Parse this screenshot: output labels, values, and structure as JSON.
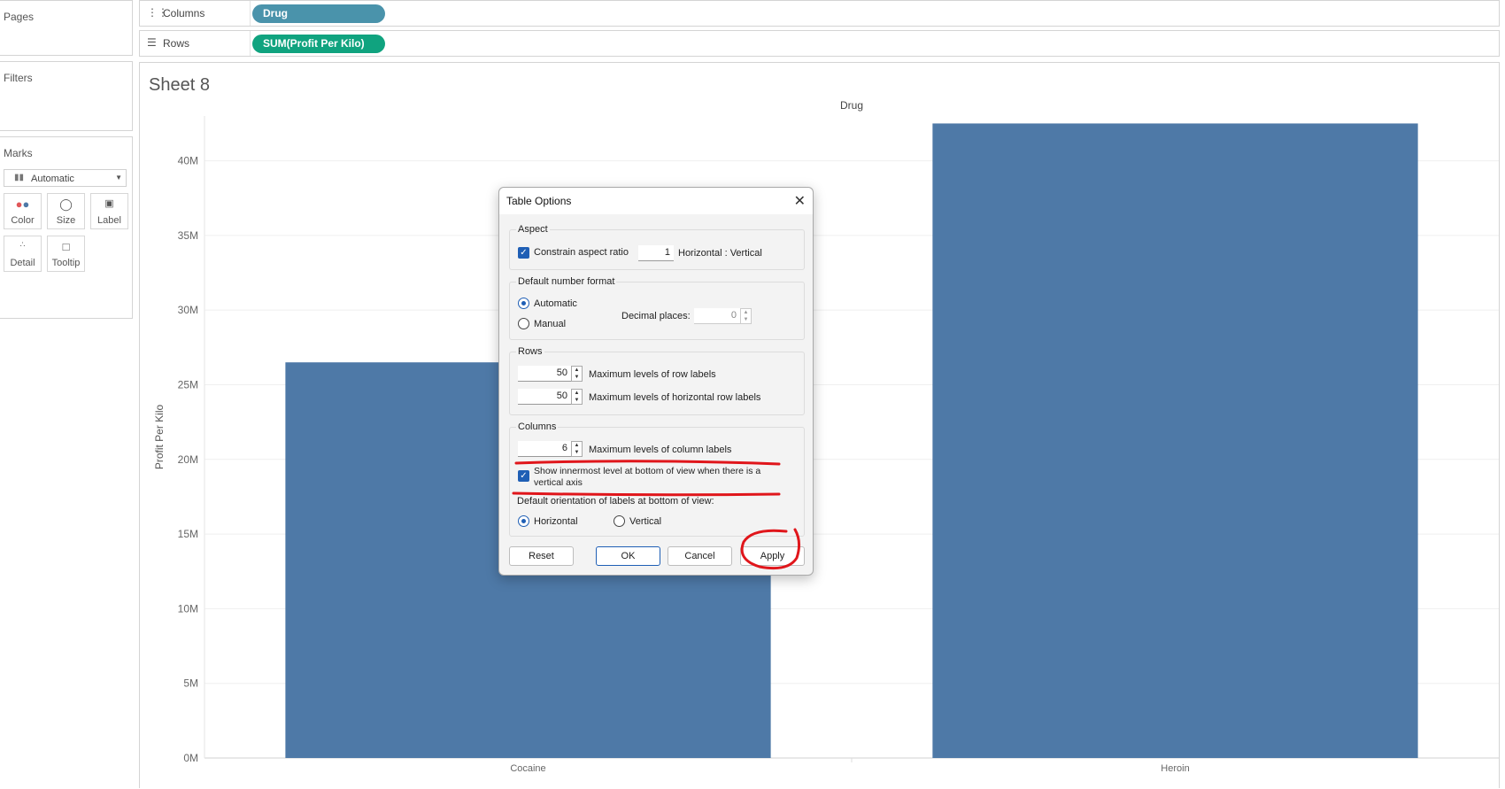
{
  "side_panes": {
    "pages_title": "Pages",
    "filters_title": "Filters",
    "marks_title": "Marks",
    "mark_type": "Automatic",
    "mark_buttons": [
      {
        "label": "Color",
        "icon": "color-dots-icon"
      },
      {
        "label": "Size",
        "icon": "size-icon"
      },
      {
        "label": "Label",
        "icon": "label-icon"
      },
      {
        "label": "Detail",
        "icon": "detail-icon"
      },
      {
        "label": "Tooltip",
        "icon": "tooltip-icon"
      }
    ]
  },
  "shelves": {
    "columns_label": "Columns",
    "columns_pill": "Drug",
    "rows_label": "Rows",
    "rows_pill": "SUM(Profit Per Kilo)"
  },
  "sheet": {
    "title": "Sheet 8"
  },
  "chart_data": {
    "type": "bar",
    "title": "",
    "column_header": "Drug",
    "categories": [
      "Cocaine",
      "Heroin"
    ],
    "values": [
      26500000,
      42500000
    ],
    "ylabel": "Profit Per Kilo",
    "ylim": [
      0,
      43000000
    ],
    "yticks": [
      "0M",
      "5M",
      "10M",
      "15M",
      "20M",
      "25M",
      "30M",
      "35M",
      "40M"
    ],
    "grid": true,
    "bar_color": "#4e79a7"
  },
  "dialog": {
    "title": "Table Options",
    "aspect": {
      "group_title": "Aspect",
      "constrain_label": "Constrain aspect ratio",
      "ratio_value": "1",
      "ratio_suffix": "Horizontal : Vertical"
    },
    "number_format": {
      "group_title": "Default number format",
      "automatic_label": "Automatic",
      "manual_label": "Manual",
      "decimal_label": "Decimal places:",
      "decimal_value": "0"
    },
    "rows": {
      "group_title": "Rows",
      "row_labels_value": "50",
      "row_labels_text": "Maximum levels of row labels",
      "horiz_row_labels_value": "50",
      "horiz_row_labels_text": "Maximum levels of horizontal row labels"
    },
    "columns": {
      "group_title": "Columns",
      "col_labels_value": "6",
      "col_labels_text": "Maximum levels of column labels",
      "innermost_line1": "Show innermost level at bottom of view when there is a",
      "innermost_line2": "vertical axis",
      "orientation_title": "Default orientation of labels at bottom of view:",
      "horizontal_label": "Horizontal",
      "vertical_label": "Vertical"
    },
    "buttons": {
      "reset": "Reset",
      "ok": "OK",
      "cancel": "Cancel",
      "apply": "Apply"
    }
  },
  "annotation_color": "#e0161b"
}
